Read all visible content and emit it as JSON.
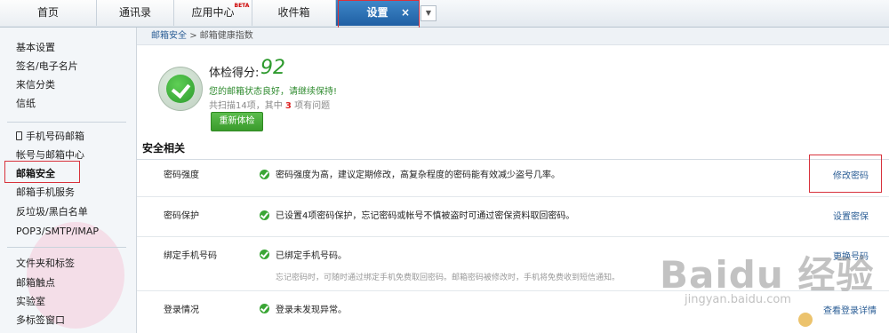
{
  "tabs": [
    {
      "label": "首页"
    },
    {
      "label": "通讯录"
    },
    {
      "label": "应用中心",
      "badge": "BETA"
    },
    {
      "label": "收件箱"
    },
    {
      "label": "设置",
      "close": "×"
    }
  ],
  "sidebar": {
    "group1": [
      "基本设置",
      "签名/电子名片",
      "来信分类",
      "信纸"
    ],
    "group2": [
      "手机号码邮箱",
      "帐号与邮箱中心",
      "邮箱安全",
      "邮箱手机服务",
      "反垃圾/黑白名单",
      "POP3/SMTP/IMAP"
    ],
    "group3": [
      "文件夹和标签",
      "邮箱触点",
      "实验室",
      "多标签窗口"
    ],
    "active": "邮箱安全"
  },
  "breadcrumb": {
    "link": "邮箱安全",
    "separator": ">",
    "current": "邮箱健康指数"
  },
  "health": {
    "score_label": "体检得分:",
    "score": "92",
    "status": "您的邮箱状态良好，请继续保持!",
    "scan_prefix": "共扫描14项，其中",
    "issue_count": "3",
    "scan_suffix": "项有问题",
    "recheck": "重新体检"
  },
  "section": {
    "title": "安全相关"
  },
  "rows": [
    {
      "label": "密码强度",
      "desc": "密码强度为高，建议定期修改，高复杂程度的密码能有效减少盗号几率。",
      "action": "修改密码"
    },
    {
      "label": "密码保护",
      "desc": "已设置4项密码保护，忘记密码或帐号不慎被盗时可通过密保资料取回密码。",
      "action": "设置密保"
    },
    {
      "label": "绑定手机号码",
      "desc": "已绑定手机号码。",
      "sub": "忘记密码时，可随时通过绑定手机免费取回密码。邮箱密码被修改时，手机将免费收到短信通知。",
      "action": "更换号码"
    },
    {
      "label": "登录情况",
      "desc": "登录未发现异常。",
      "action": "查看登录详情"
    }
  ],
  "watermark": {
    "brand": "Baidu 经验",
    "url": "jingyan.baidu.com"
  },
  "colors": {
    "accent": "#1f5fa3",
    "ok": "#3aa635",
    "link": "#2a5d95",
    "highlight": "#d8323c"
  }
}
